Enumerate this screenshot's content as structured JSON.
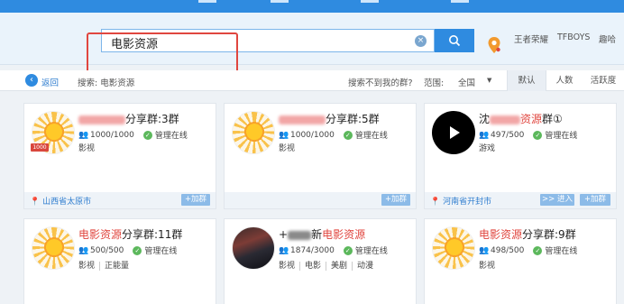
{
  "search": {
    "value": "电影资源",
    "clear_glyph": "×"
  },
  "top_links": [
    "王者荣耀",
    "TFBOYS",
    "趣哈"
  ],
  "filter_bar": {
    "back": "返回",
    "search_prefix": "搜索:",
    "search_term": "电影资源",
    "not_found": "搜索不到我的群?",
    "range_label": "范围:",
    "range_value": "全国",
    "sort_tabs": [
      "默认",
      "人数",
      "活跃度"
    ],
    "active_sort": "默认"
  },
  "cards": [
    {
      "level": "1000",
      "name_suffix": "分享群:3群",
      "members": "1000/1000",
      "status": "管理在线",
      "tags": [
        "影视"
      ],
      "location": "山西省太原市",
      "join": "+加群"
    },
    {
      "name_suffix": "分享群:5群",
      "members": "1000/1000",
      "status": "管理在线",
      "tags": [
        "影视"
      ],
      "join": "+加群"
    },
    {
      "name_prefix": "沈",
      "name_hl": "资源",
      "name_suffix": "群①",
      "members": "497/500",
      "status": "管理在线",
      "tags": [
        "游戏"
      ],
      "location": "河南省开封市",
      "enter": ">> 进入",
      "join": "+加群"
    },
    {
      "name_hl": "电影资源",
      "name_suffix": "分享群:11群",
      "members": "500/500",
      "status": "管理在线",
      "tags": [
        "影视",
        "正能量"
      ]
    },
    {
      "name_prefix": "+",
      "name_mid": "新",
      "name_hl": "电影资源",
      "members": "1874/3000",
      "status": "管理在线",
      "tags": [
        "影视",
        "电影",
        "美剧",
        "动漫"
      ]
    },
    {
      "name_hl": "电影资源",
      "name_suffix": "分享群:9群",
      "members": "498/500",
      "status": "管理在线",
      "tags": [
        "影视"
      ]
    }
  ]
}
